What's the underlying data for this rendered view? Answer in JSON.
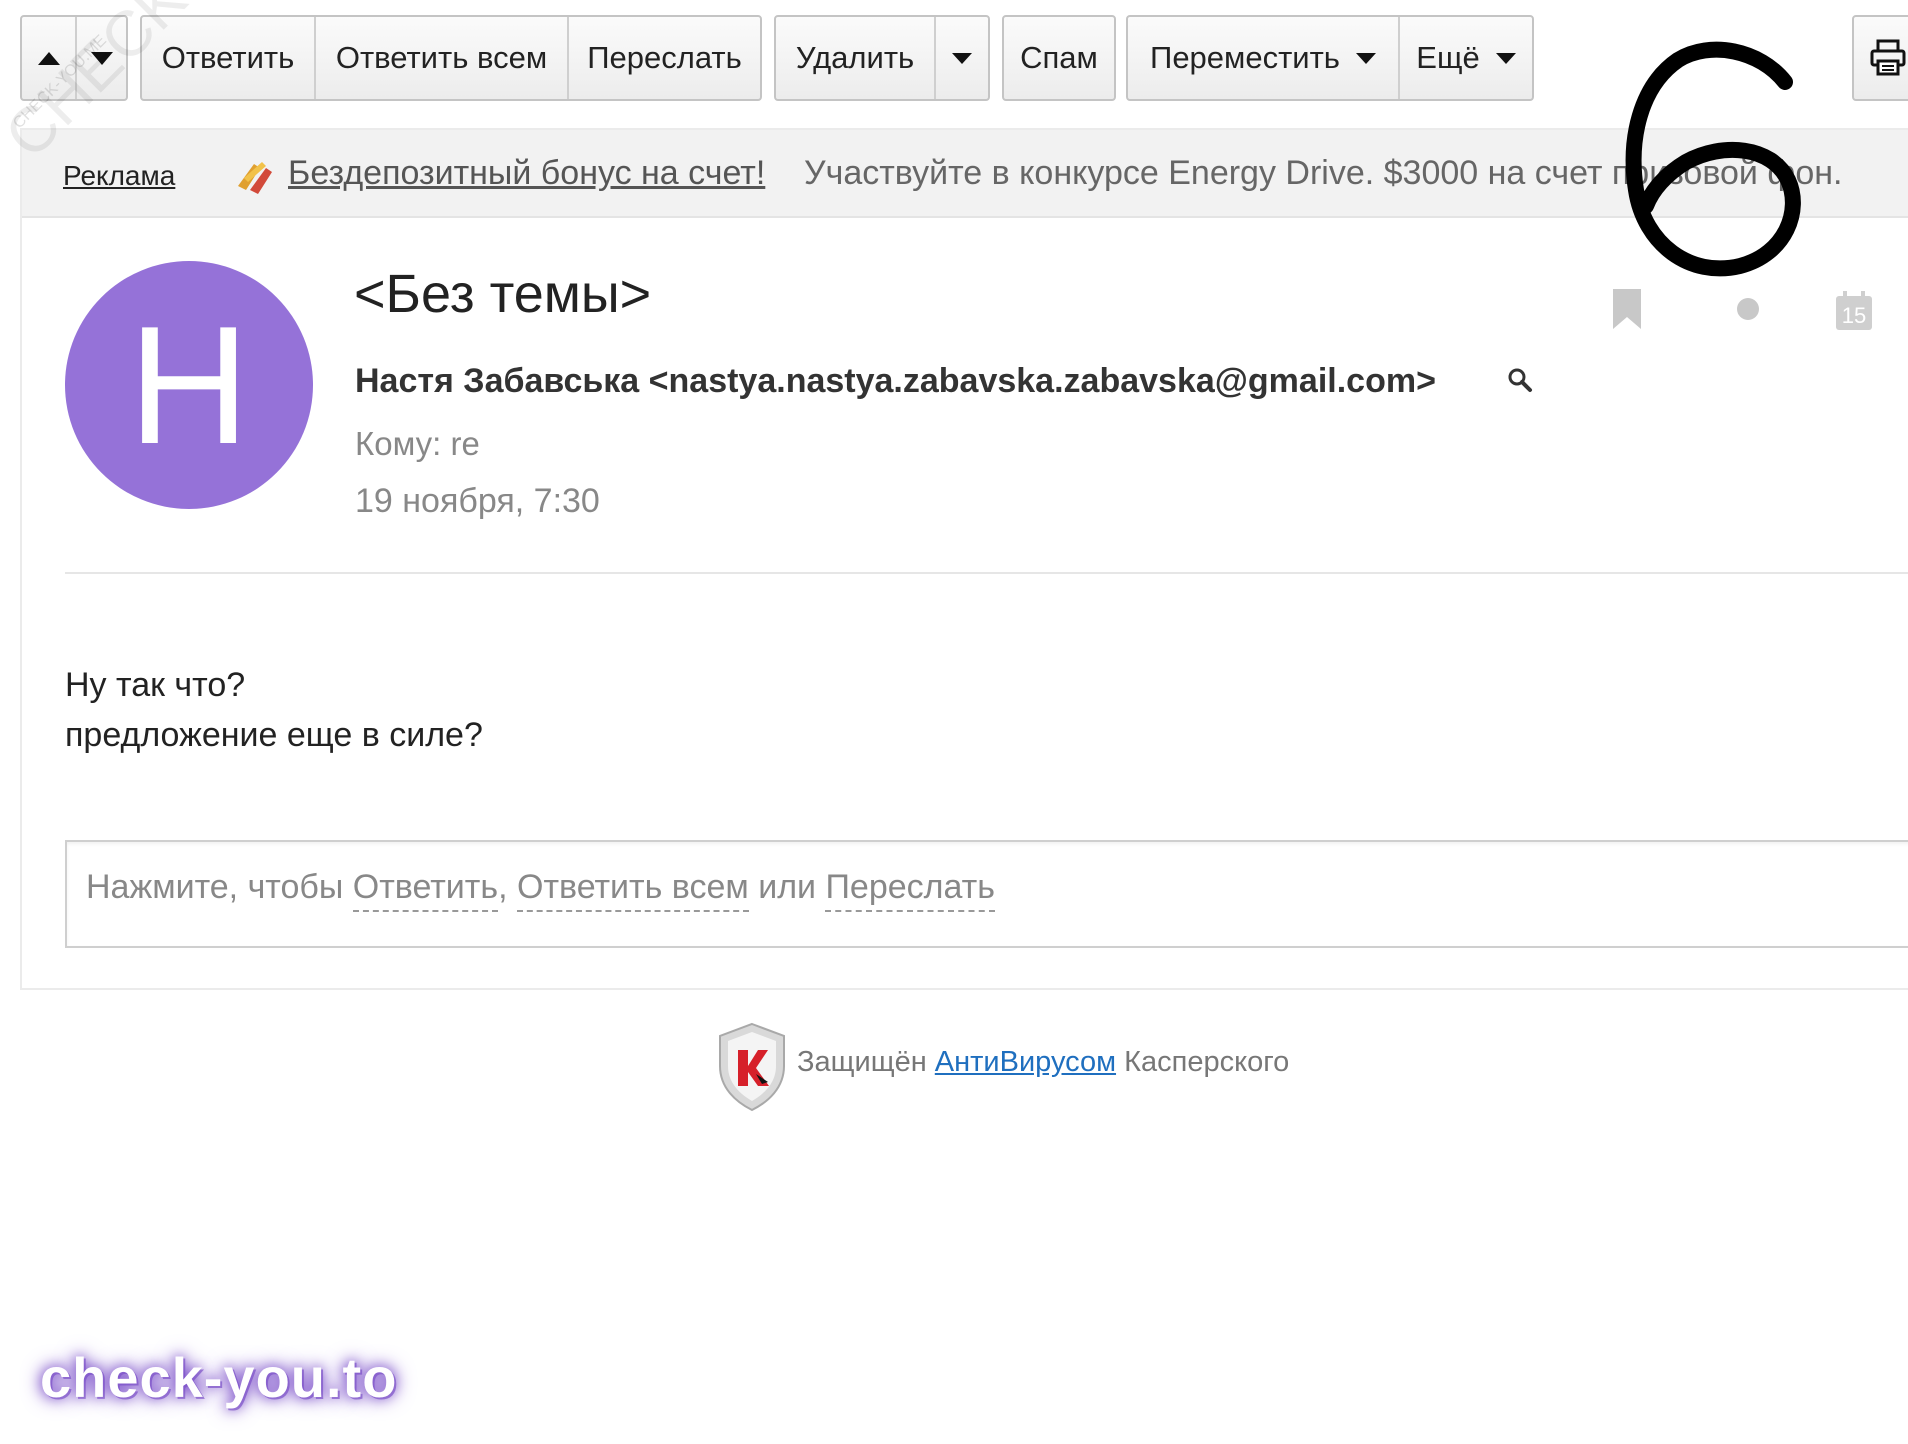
{
  "toolbar": {
    "reply": "Ответить",
    "reply_all": "Ответить всем",
    "forward": "Переслать",
    "delete": "Удалить",
    "spam": "Спам",
    "move": "Переместить",
    "more": "Ещё",
    "icons": {
      "prev": "arrow-up-icon",
      "next": "arrow-down-icon",
      "print": "printer-icon"
    }
  },
  "ad": {
    "label": "Реклама",
    "link": "Бездепозитный бонус на счет!",
    "text": "Участвуйте в конкурсе Energy Drive. $3000 на счет призовой фон."
  },
  "message": {
    "avatar_letter": "Н",
    "avatar_color": "#9572d8",
    "subject": "<Без темы>",
    "sender": "Настя Забавська <nastya.nastya.zabavska.zabavska@gmail.com>",
    "recipient_label": "Кому:",
    "recipient_value": "re",
    "date": "19 ноября, 7:30",
    "calendar_day": "15",
    "body_lines": [
      "Ну так что?",
      "предложение еще в силе?"
    ]
  },
  "reply_box": {
    "prefix": "Нажмите, чтобы",
    "reply": "Ответить",
    "sep1": ",",
    "reply_all": "Ответить всем",
    "or": "или",
    "forward": "Переслать"
  },
  "footer": {
    "protected": "Защищён",
    "antivirus": "АнтиВирусом",
    "kaspersky": "Касперского"
  },
  "overlay": {
    "handwritten_number": "6",
    "watermark_bottom": "check-you.to",
    "watermark_diag": "CHECK-YOU.ME",
    "watermark_small": "CHECK-YOU.ME"
  },
  "colors": {
    "accent_link": "#1f6fbf",
    "avatar": "#9572d8"
  }
}
